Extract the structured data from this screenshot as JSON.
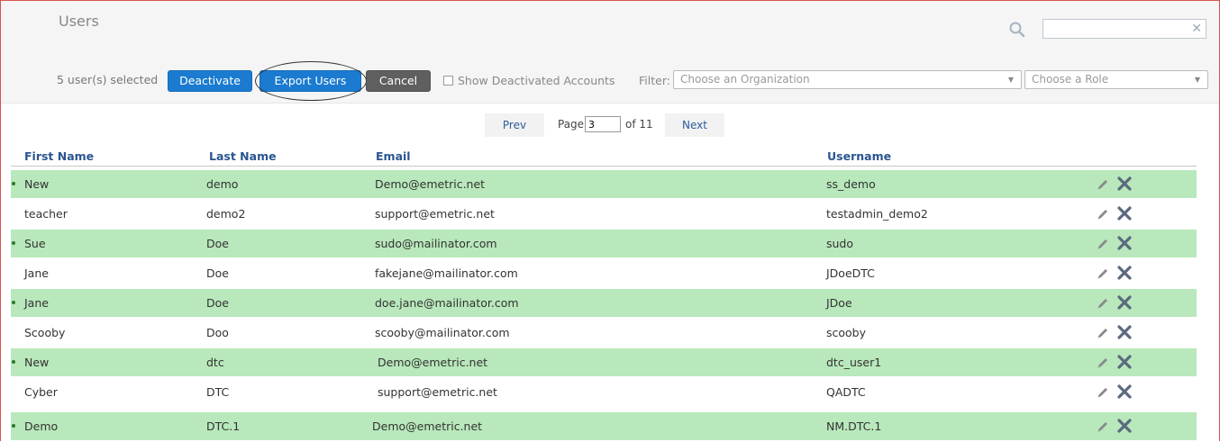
{
  "header": {
    "title": "Users",
    "search": {
      "value": "",
      "placeholder": ""
    }
  },
  "toolbar": {
    "selected_text": "5 user(s) selected",
    "deactivate_label": "Deactivate",
    "export_label": "Export Users",
    "cancel_label": "Cancel",
    "show_deactivated_label": "Show Deactivated Accounts",
    "filter_label": "Filter:",
    "organization_select": "Choose an Organization",
    "role_select": "Choose a Role"
  },
  "pagination": {
    "prev_label": "Prev",
    "page_label": "Page",
    "current_page": "3",
    "of_label": "of 11",
    "next_label": "Next"
  },
  "table": {
    "columns": [
      "First Name",
      "Last Name",
      "Email",
      "Username"
    ],
    "rows": [
      {
        "first": "New",
        "last": "demo",
        "email": "Demo@emetric.net",
        "username": "ss_demo",
        "selected": true
      },
      {
        "first": "teacher",
        "last": "demo2",
        "email": "support@emetric.net",
        "username": "testadmin_demo2",
        "selected": false
      },
      {
        "first": "Sue",
        "last": "Doe",
        "email": "sudo@mailinator.com",
        "username": "sudo",
        "selected": true
      },
      {
        "first": "Jane",
        "last": "Doe",
        "email": "fakejane@mailinator.com",
        "username": "JDoeDTC",
        "selected": false
      },
      {
        "first": "Jane",
        "last": "Doe",
        "email": "doe.jane@mailinator.com",
        "username": "JDoe",
        "selected": true
      },
      {
        "first": "Scooby",
        "last": "Doo",
        "email": "scooby@mailinator.com",
        "username": "scooby",
        "selected": false
      },
      {
        "first": "New",
        "last": "dtc",
        "email": "Demo@emetric.net",
        "username": "dtc_user1",
        "selected": true
      },
      {
        "first": "Cyber",
        "last": "DTC",
        "email": "support@emetric.net",
        "username": "QADTC",
        "selected": false
      },
      {
        "first": "Demo",
        "last": "DTC.1",
        "email": "Demo@emetric.net",
        "username": "NM.DTC.1",
        "selected": true
      }
    ]
  },
  "colors": {
    "accent_blue": "#1a7bd0",
    "selected_row": "#b8e8bb",
    "header_text": "#2a5590",
    "frame_border": "#d9534f"
  },
  "icons": {
    "search": "search-icon",
    "clear": "close-icon",
    "edit": "pencil-icon",
    "delete": "x-icon"
  }
}
